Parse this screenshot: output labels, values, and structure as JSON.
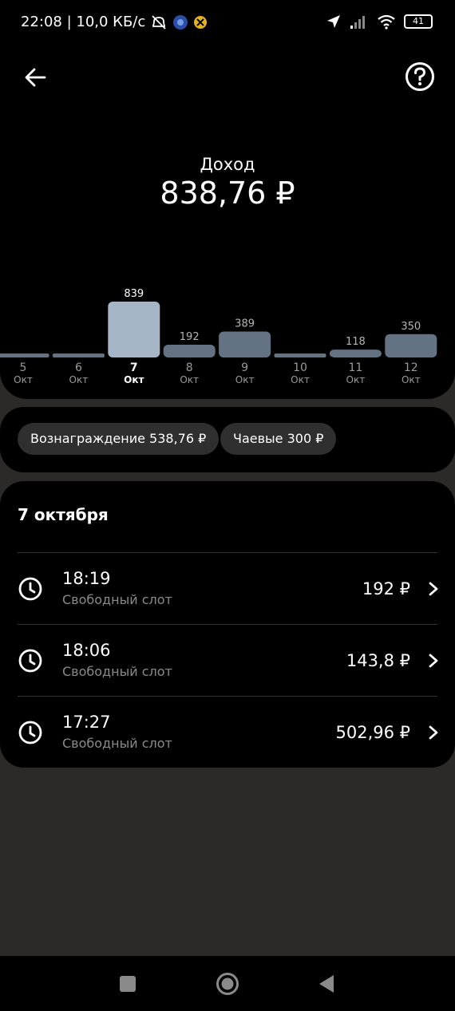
{
  "status_bar": {
    "time_speed": "22:08 | 10,0 КБ/с",
    "battery": "41"
  },
  "header": {
    "title": "Доход",
    "amount": "838,76 ₽"
  },
  "chart_data": {
    "type": "bar",
    "categories": [
      "5",
      "6",
      "7",
      "8",
      "9",
      "10",
      "11",
      "12"
    ],
    "sublabels": [
      "Окт",
      "Окт",
      "Окт",
      "Окт",
      "Окт",
      "Окт",
      "Окт",
      "Окт"
    ],
    "values": [
      0,
      0,
      839,
      192,
      389,
      0,
      118,
      350
    ],
    "value_labels": [
      "",
      "",
      "839",
      "192",
      "389",
      "",
      "118",
      "350"
    ],
    "selected_index": 2,
    "colors": {
      "bar": "#647384",
      "selected": "#a7b6c6"
    }
  },
  "chips": [
    {
      "label": "Вознаграждение 538,76 ₽"
    },
    {
      "label": "Чаевые 300 ₽"
    }
  ],
  "list": {
    "day_title": "7 октября",
    "items": [
      {
        "time": "18:19",
        "subtitle": "Свободный слот",
        "price": "192 ₽"
      },
      {
        "time": "18:06",
        "subtitle": "Свободный слот",
        "price": "143,8 ₽"
      },
      {
        "time": "17:27",
        "subtitle": "Свободный слот",
        "price": "502,96 ₽"
      }
    ]
  }
}
